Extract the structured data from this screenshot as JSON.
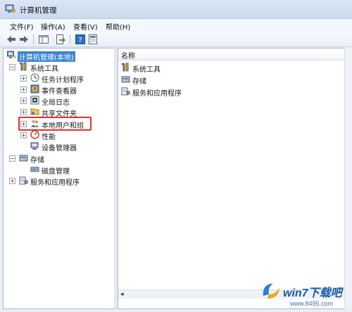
{
  "window": {
    "title": "计算机管理"
  },
  "menu": {
    "file": "文件(F)",
    "action": "操作(A)",
    "view": "查看(V)",
    "help": "帮助(H)"
  },
  "toolbar": {
    "buttons": [
      "back-arrow-icon",
      "forward-arrow-icon",
      "show-hide-tree-icon",
      "export-icon",
      "help-icon",
      "properties-icon"
    ]
  },
  "tree": {
    "root": "计算机管理(本地)",
    "system_tools": "系统工具",
    "task_scheduler": "任务计划程序",
    "event_viewer": "事件查看器",
    "global_log": "全局日志",
    "shared_folders": "共享文件夹",
    "local_users": "本地用户和组",
    "performance": "性能",
    "device_manager": "设备管理器",
    "storage": "存储",
    "disk_management": "磁盘管理",
    "services_apps": "服务和应用程序"
  },
  "list": {
    "column_name": "名称",
    "items": [
      "系统工具",
      "存储",
      "服务和应用程序"
    ]
  },
  "watermark": {
    "brand": "win7下载吧",
    "url": "www.8495.com"
  },
  "colors": {
    "selection": "#3b84d8",
    "highlight_box": "#e5302a",
    "title_bar": "#c9d9ef"
  }
}
